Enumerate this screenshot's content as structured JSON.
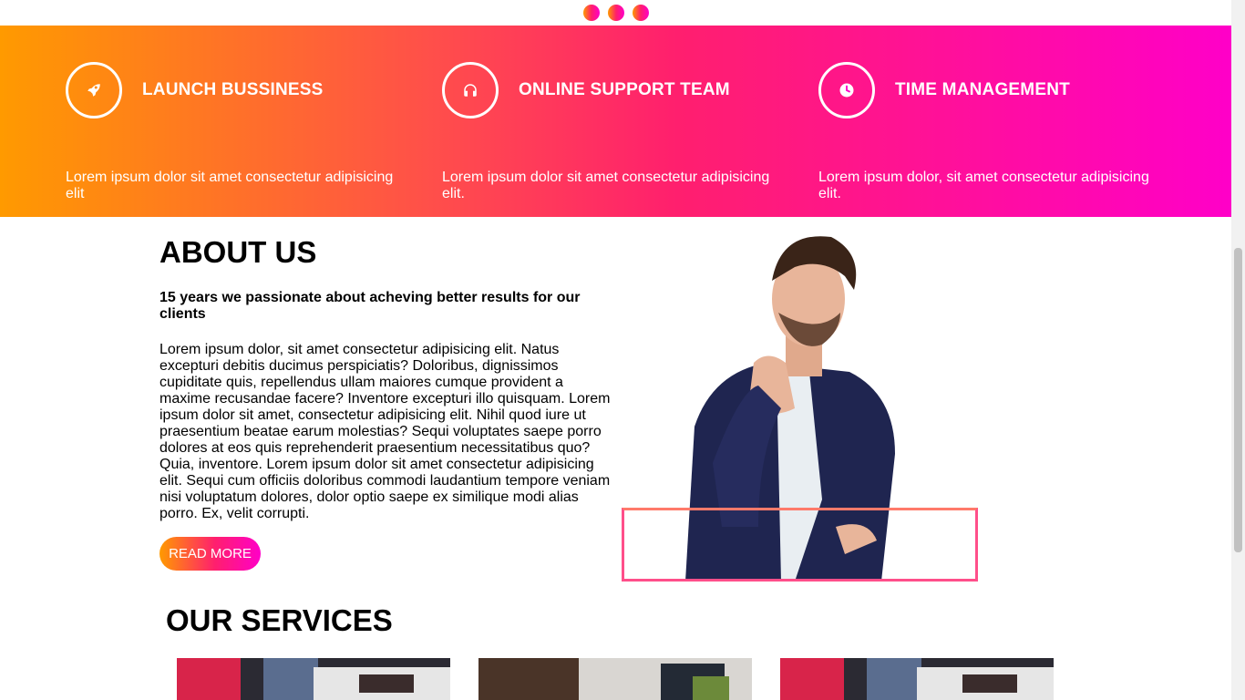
{
  "carousel": {
    "dots": 3
  },
  "features": [
    {
      "title": "LAUNCH BUSSINESS",
      "text": "Lorem ipsum dolor sit amet consectetur adipisicing elit",
      "icon": "rocket-icon"
    },
    {
      "title": "ONLINE SUPPORT TEAM",
      "text": "Lorem ipsum dolor sit amet consectetur adipisicing elit.",
      "icon": "headphones-icon"
    },
    {
      "title": "TIME MANAGEMENT",
      "text": "Lorem ipsum dolor, sit amet consectetur adipisicing elit.",
      "icon": "clock-icon"
    }
  ],
  "about": {
    "title": "ABOUT US",
    "subtitle": "15 years we passionate about acheving better results for our clients",
    "body": "Lorem ipsum dolor, sit amet consectetur adipisicing elit. Natus excepturi debitis ducimus perspiciatis? Doloribus, dignissimos cupiditate quis, repellendus ullam maiores cumque provident a maxime recusandae facere? Inventore excepturi illo quisquam. Lorem ipsum dolor sit amet, consectetur adipisicing elit. Nihil quod iure ut praesentium beatae earum molestias? Sequi voluptates saepe porro dolores at eos quis reprehenderit praesentium necessitatibus quo? Quia, inventore. Lorem ipsum dolor sit amet consectetur adipisicing elit. Sequi cum officiis doloribus commodi laudantium tempore veniam nisi voluptatum dolores, dolor optio saepe ex similique modi alias porro. Ex, velit corrupti.",
    "button": "READ MORE"
  },
  "services": {
    "title": "OUR SERVICES"
  },
  "colors": {
    "gradient_start": "#ff9a00",
    "gradient_mid": "#ff1f6e",
    "gradient_end": "#ff00c8"
  }
}
